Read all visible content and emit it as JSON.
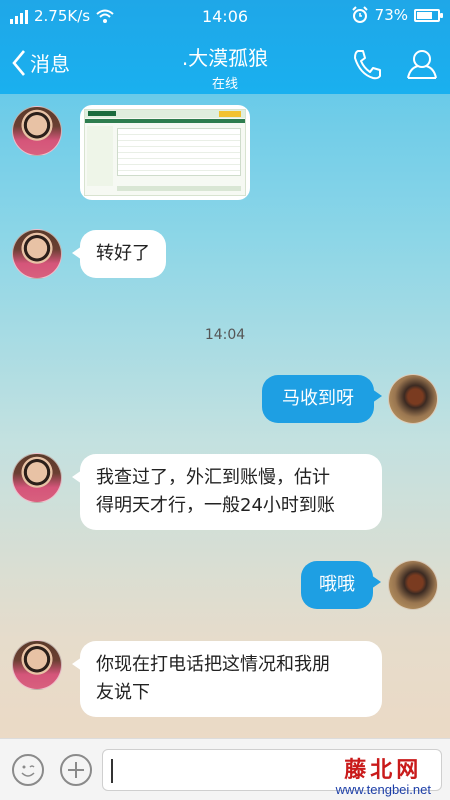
{
  "status_bar": {
    "network_speed": "2.75K/s",
    "time": "14:06",
    "battery": "73%",
    "battery_level": 0.73
  },
  "header": {
    "back_label": "消息",
    "contact_name": ".大漠孤狼",
    "contact_status": "在线",
    "icons": [
      "phone-icon",
      "profile-icon"
    ]
  },
  "messages": [
    {
      "sender": "contact",
      "type": "image"
    },
    {
      "sender": "contact",
      "type": "text",
      "text": "转好了"
    },
    {
      "type": "timestamp",
      "text": "14:04"
    },
    {
      "sender": "self",
      "type": "text",
      "text": "马收到呀"
    },
    {
      "sender": "contact",
      "type": "text",
      "lines": [
        "我查过了，外汇到账慢，估计",
        "得明天才行，一般24小时到账"
      ]
    },
    {
      "sender": "self",
      "type": "text",
      "text": "哦哦"
    },
    {
      "sender": "contact",
      "type": "text",
      "lines": [
        "你现在打电话把这情况和我朋",
        "友说下"
      ]
    }
  ],
  "input_bar": {
    "icons": [
      "emoji-icon",
      "add-icon"
    ]
  },
  "watermark": {
    "main": "藤北网",
    "url": "www.tengbei.net"
  },
  "colors": {
    "header_blue": "#1ab0ef",
    "self_bubble": "#1e9fe3",
    "contact_bubble": "#ffffff",
    "watermark_red": "#c91a1a"
  }
}
